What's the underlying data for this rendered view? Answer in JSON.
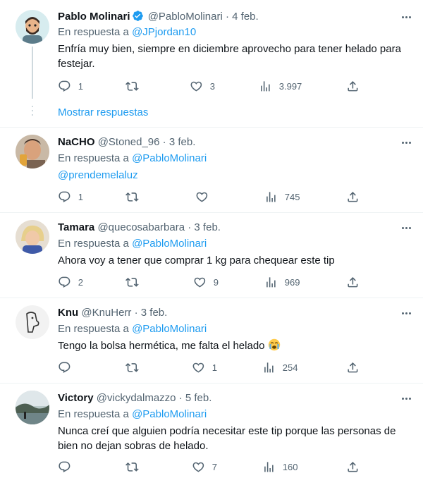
{
  "colors": {
    "accent": "#1d9bf0",
    "muted": "#536471",
    "text": "#0f1419",
    "border": "#eff3f4"
  },
  "reply_prefix": "En respuesta a",
  "show_replies_label": "Mostrar respuestas",
  "tweets": [
    {
      "name": "Pablo Molinari",
      "verified": true,
      "handle": "@PabloMolinari",
      "date": "4 feb.",
      "reply_to": "@JPjordan10",
      "text": "Enfría muy bien, siempre en diciembre aprovecho para tener helado para festejar.",
      "replies": "1",
      "retweets": "",
      "likes": "3",
      "views": "3.997"
    },
    {
      "name": "NaCHO",
      "handle": "@Stoned_96",
      "date": "3 feb.",
      "reply_to": "@PabloMolinari",
      "text": "@prendemelaluz",
      "replies": "1",
      "retweets": "",
      "likes": "",
      "views": "745"
    },
    {
      "name": "Tamara",
      "handle": "@quecosabarbara",
      "date": "3 feb.",
      "reply_to": "@PabloMolinari",
      "text": "Ahora voy a tener que comprar 1 kg para chequear este tip",
      "replies": "2",
      "retweets": "",
      "likes": "9",
      "views": "969"
    },
    {
      "name": "Knu",
      "handle": "@KnuHerr",
      "date": "3 feb.",
      "reply_to": "@PabloMolinari",
      "text": "Tengo la bolsa hermética, me falta el helado",
      "emoji": "😭",
      "replies": "",
      "retweets": "",
      "likes": "1",
      "views": "254"
    },
    {
      "name": "Victory",
      "handle": "@vickydalmazzo",
      "date": "5 feb.",
      "reply_to": "@PabloMolinari",
      "text": "Nunca creí que alguien podría necesitar este tip porque las personas de bien no dejan sobras de helado.",
      "replies": "",
      "retweets": "",
      "likes": "7",
      "views": "160"
    }
  ]
}
